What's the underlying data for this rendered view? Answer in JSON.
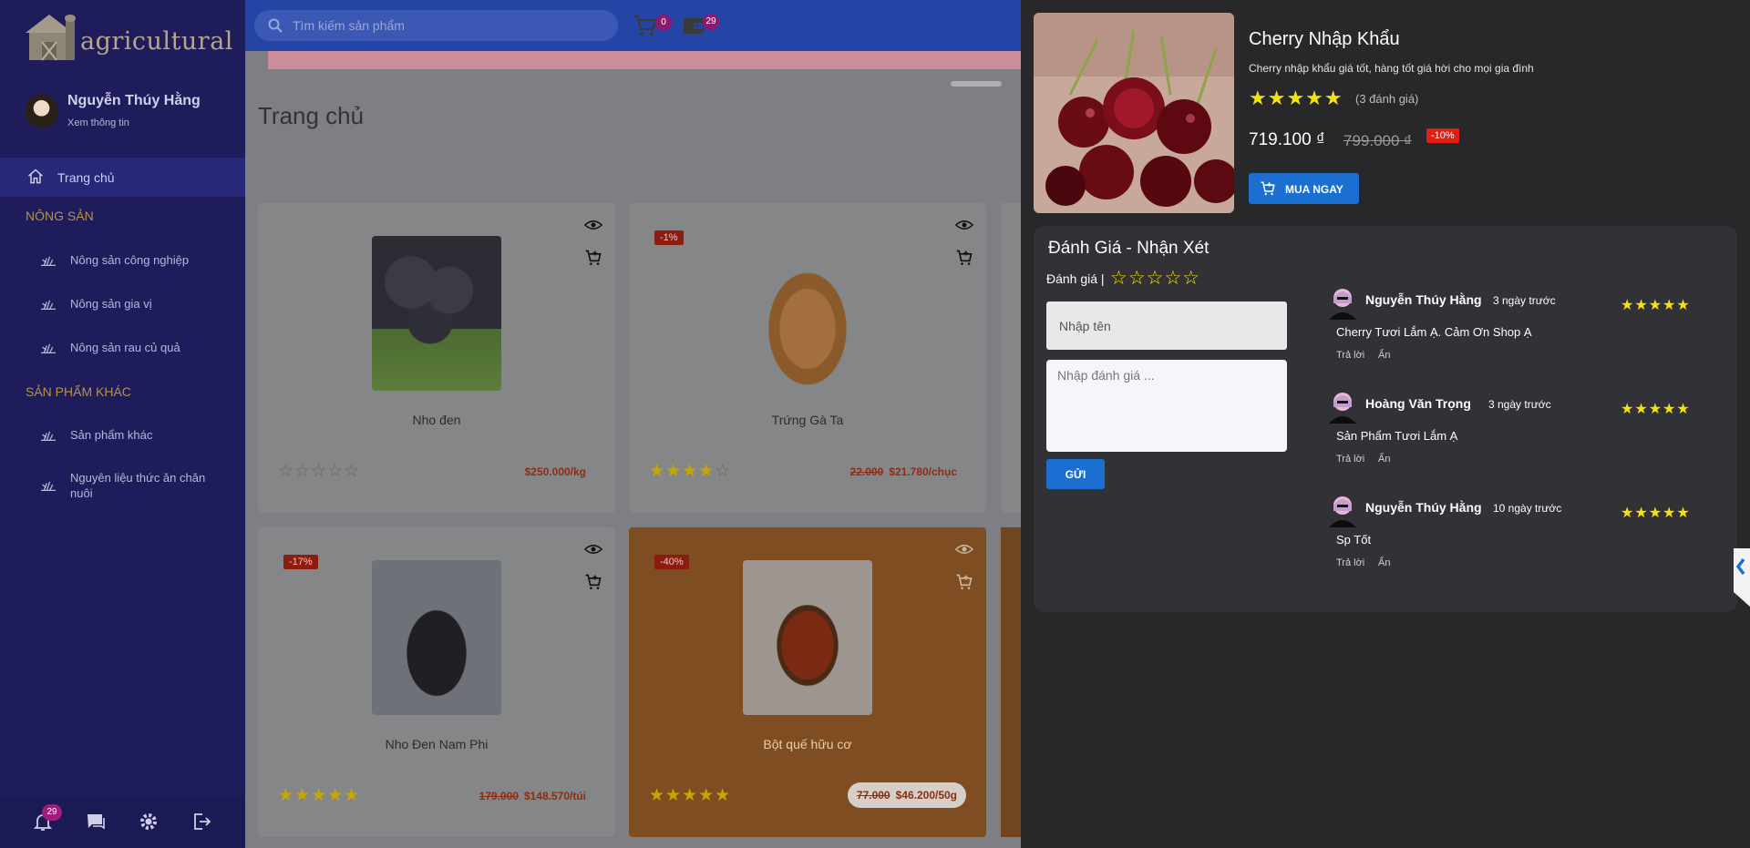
{
  "sidebar": {
    "logo_text": "agricultural",
    "user_name": "Nguyễn Thúy Hằng",
    "user_link": "Xem thông tin",
    "home_label": "Trang chủ",
    "section_1": "NÔNG SẢN",
    "section_2": "SẢN PHẨM KHÁC",
    "items": [
      {
        "label": "Nông sản công nghiệp"
      },
      {
        "label": "Nông sản gia vị"
      },
      {
        "label": "Nông sản rau củ quả"
      },
      {
        "label": "Sản phẩm khác"
      },
      {
        "label": "Nguyên liệu thức ăn chăn nuôi"
      }
    ],
    "notification_count": "29"
  },
  "topbar": {
    "search_placeholder": "Tìm kiếm sản phẩm",
    "cart_count": "0",
    "wallet_count": "29"
  },
  "main": {
    "page_title": "Trang chủ",
    "products": [
      {
        "name": "Nho đen",
        "discount": "",
        "old_price": "",
        "price": "$250.000/kg",
        "rating": 0
      },
      {
        "name": "Trứng Gà Ta",
        "discount": "-1%",
        "old_price": "22.000",
        "price": "$21.780/chục",
        "rating": 4
      },
      {
        "name": "Nho Đen Nam Phi",
        "discount": "-17%",
        "old_price": "179.000",
        "price": "$148.570/túi",
        "rating": 5
      },
      {
        "name": "Bột quế hữu cơ",
        "discount": "-40%",
        "old_price": "77.000",
        "price": "$46.200/50g",
        "rating": 5
      }
    ]
  },
  "detail": {
    "title": "Cherry Nhập Khẩu",
    "description": "Cherry nhập khẩu giá tốt, hàng tốt giá hời cho mọi gia đình",
    "review_count": "(3 đánh giá)",
    "price": "719.100 ₫",
    "old_price": "799.000 ₫",
    "discount": "-10%",
    "buy_label": "MUA NGAY",
    "rating": 5
  },
  "review_panel": {
    "title": "Đánh Giá - Nhận Xét",
    "rate_label": "Đánh giá |",
    "name_placeholder": "Nhập tên",
    "comment_placeholder": "Nhập đánh giá ...",
    "send_label": "GỬI",
    "reviews": [
      {
        "name": "Nguyễn Thúy Hằng",
        "time": "3 ngày trước",
        "text": "Cherry Tươi Lắm Ạ. Cảm Ơn Shop Ạ",
        "reply": "Trả lời",
        "hide": "Ẩn",
        "rating": 5
      },
      {
        "name": "Hoàng Văn Trọng",
        "time": "3 ngày trước",
        "text": "Sản Phẩm Tươi Lắm Ạ",
        "reply": "Trả lời",
        "hide": "Ẩn",
        "rating": 5
      },
      {
        "name": "Nguyễn Thúy Hằng",
        "time": "10 ngày trước",
        "text": "Sp Tốt",
        "reply": "Trả lời",
        "hide": "Ẩn",
        "rating": 5
      }
    ]
  },
  "colors": {
    "sidebar_bg": "#1f1c5c",
    "topbar_bg": "#2545a6",
    "drawer_bg": "#28282b",
    "accent_blue": "#1a6fd0",
    "star_yellow": "#f4e20c",
    "discount_red": "#e01e12"
  }
}
